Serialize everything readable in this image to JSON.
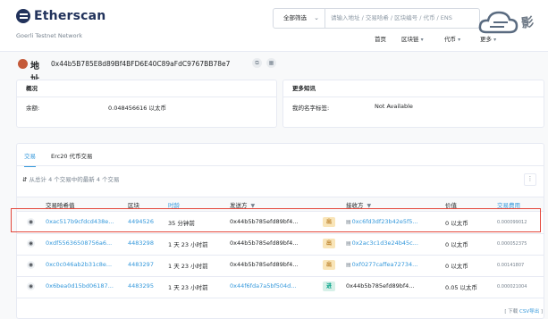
{
  "header": {
    "brand": "Etherscan",
    "network": "Goerli Testnet Network",
    "filter": "全部筛选",
    "search_placeholder": "请输入地址 / 交易哈希 / 区块编号 / 代币 / ENS",
    "nav": [
      {
        "label": "首页",
        "has_menu": false
      },
      {
        "label": "区块链",
        "has_menu": true
      },
      {
        "label": "代币",
        "has_menu": true
      },
      {
        "label": "更多",
        "has_menu": true
      }
    ],
    "watermark": "影"
  },
  "address": {
    "title": "地址",
    "value": "0x44b5B785E8d89Bf4BFD6E40C89aFdC9767BB78e7"
  },
  "overview": {
    "title": "概况",
    "balance_label": "余额:",
    "balance_value": "0.048456616 以太币"
  },
  "more_info": {
    "title": "更多知讯",
    "tag_label": "我的名字标签:",
    "tag_value": "Not Available"
  },
  "tabs": [
    "交易",
    "Erc20 代币交易"
  ],
  "summary": "从总计 4 个交易中的最新 4 个交易",
  "table": {
    "headers": [
      "交易哈希值",
      "区块",
      "时龄",
      "发送方",
      "接收方",
      "价值",
      "交易费用"
    ],
    "rows": [
      {
        "hash": "0xac517b9cfdcd438e...",
        "block": "4494526",
        "age": "35 分钟前",
        "from": "0x44b5b785efd89bf4...",
        "dir": "出",
        "to": "0xc6fd3df23b42e5f5...",
        "value": "0 以太币",
        "fee": "0.000099012",
        "to_contract": true
      },
      {
        "hash": "0xdf55636508756a6...",
        "block": "4483298",
        "age": "1 天 23 小时前",
        "from": "0x44b5b785efd89bf4...",
        "dir": "出",
        "to": "0x2ac3c1d3e24b45c...",
        "value": "0 以太币",
        "fee": "0.000052375",
        "to_contract": true
      },
      {
        "hash": "0xc0c046ab2b31c8e...",
        "block": "4483297",
        "age": "1 天 23 小时前",
        "from": "0x44b5b785efd89bf4...",
        "dir": "出",
        "to": "0xf0277caffea72734...",
        "value": "0 以太币",
        "fee": "0.00141807",
        "to_contract": true
      },
      {
        "hash": "0x6bea0d15bd06187...",
        "block": "4483295",
        "age": "1 天 23 小时前",
        "from": "0x44f6fda7a5bf504d...",
        "dir": "进",
        "to": "0x44b5b785efd89bf4...",
        "value": "0.05 以太币",
        "fee": "0.000021004",
        "to_contract": false
      }
    ]
  },
  "footer": {
    "prefix": "[ 下载 ",
    "link": "CSV导出",
    "suffix": " ]"
  }
}
